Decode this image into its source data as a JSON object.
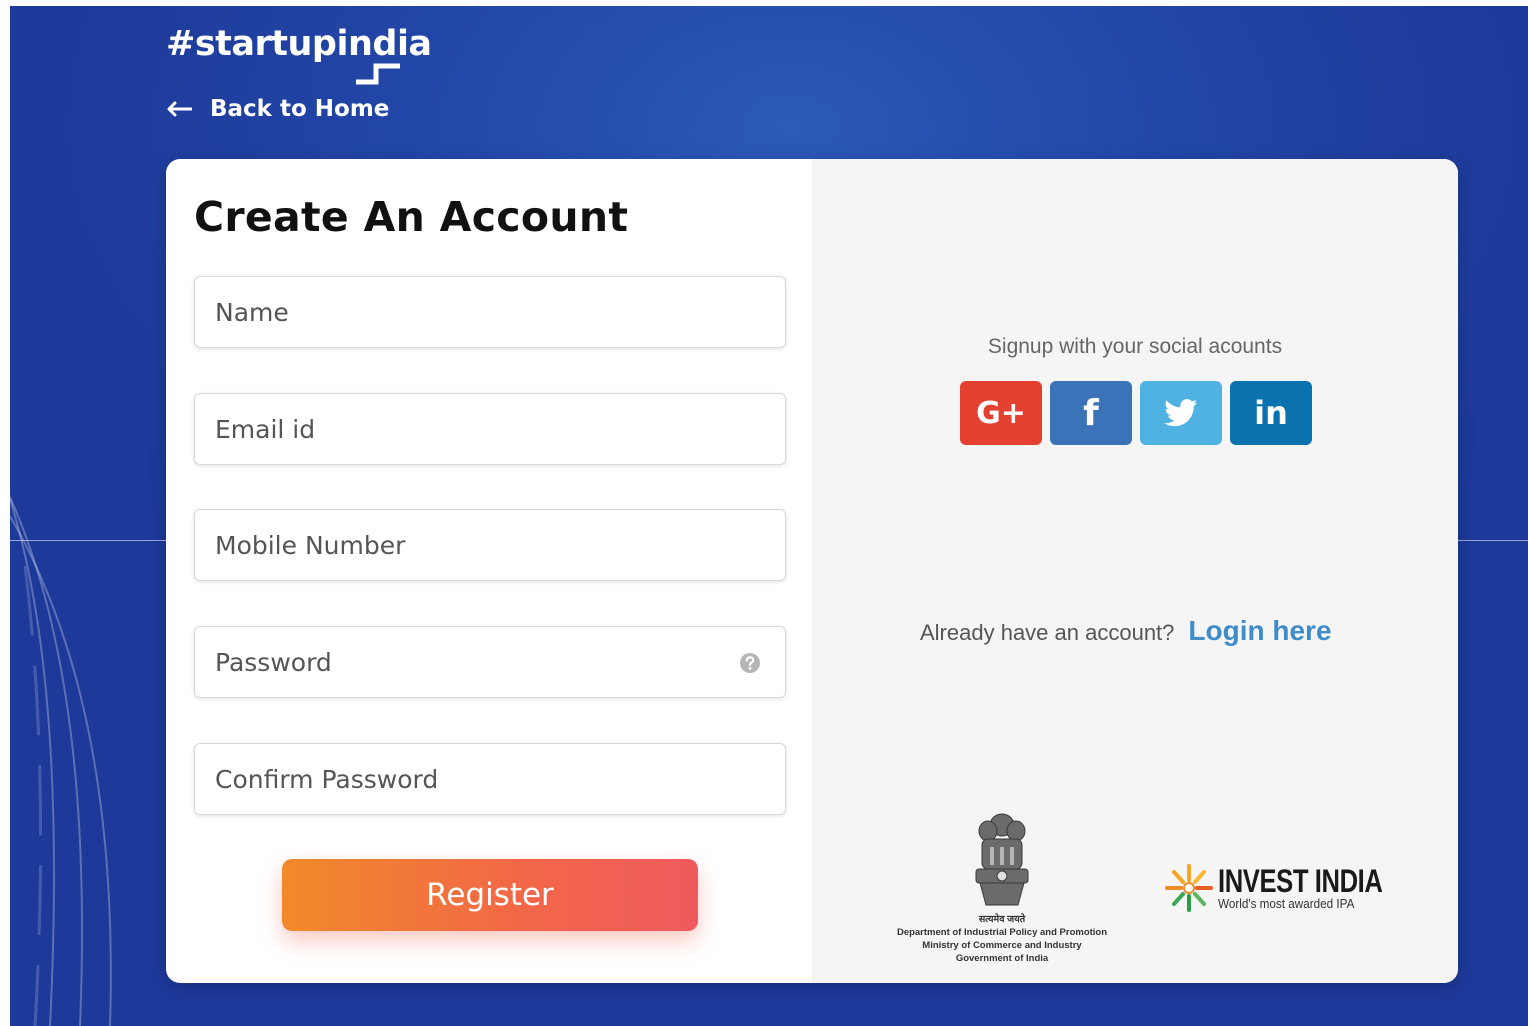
{
  "brand": {
    "logo_text": "#startupindia",
    "back_link": "Back to Home"
  },
  "form": {
    "title": "Create An Account",
    "fields": [
      {
        "placeholder": "Name"
      },
      {
        "placeholder": "Email id"
      },
      {
        "placeholder": "Mobile Number"
      },
      {
        "placeholder": "Password"
      },
      {
        "placeholder": "Confirm Password"
      }
    ],
    "register_label": "Register"
  },
  "social": {
    "label": "Signup with your social acounts",
    "buttons": [
      {
        "icon": "google-plus-icon",
        "text": "G+",
        "color": "#e4402f"
      },
      {
        "icon": "facebook-icon",
        "text": "f",
        "color": "#3a73b8"
      },
      {
        "icon": "twitter-icon",
        "text": "",
        "color": "#4fb2e3"
      },
      {
        "icon": "linkedin-icon",
        "text": "in",
        "color": "#0a72ae"
      }
    ]
  },
  "login": {
    "question": "Already have an account?",
    "link": "Login here"
  },
  "footer": {
    "emblem_lines": [
      "सत्यमेव जयते",
      "Department of Industrial Policy and Promotion",
      "Ministry of Commerce and Industry",
      "Government of India"
    ],
    "invest_name": "INVEST INDIA",
    "invest_tagline": "World's most awarded IPA"
  },
  "colors": {
    "background": "#1f3c9c",
    "register_start": "#f18a2a",
    "register_end": "#ef5a5e",
    "login_link": "#3f8cc8"
  }
}
